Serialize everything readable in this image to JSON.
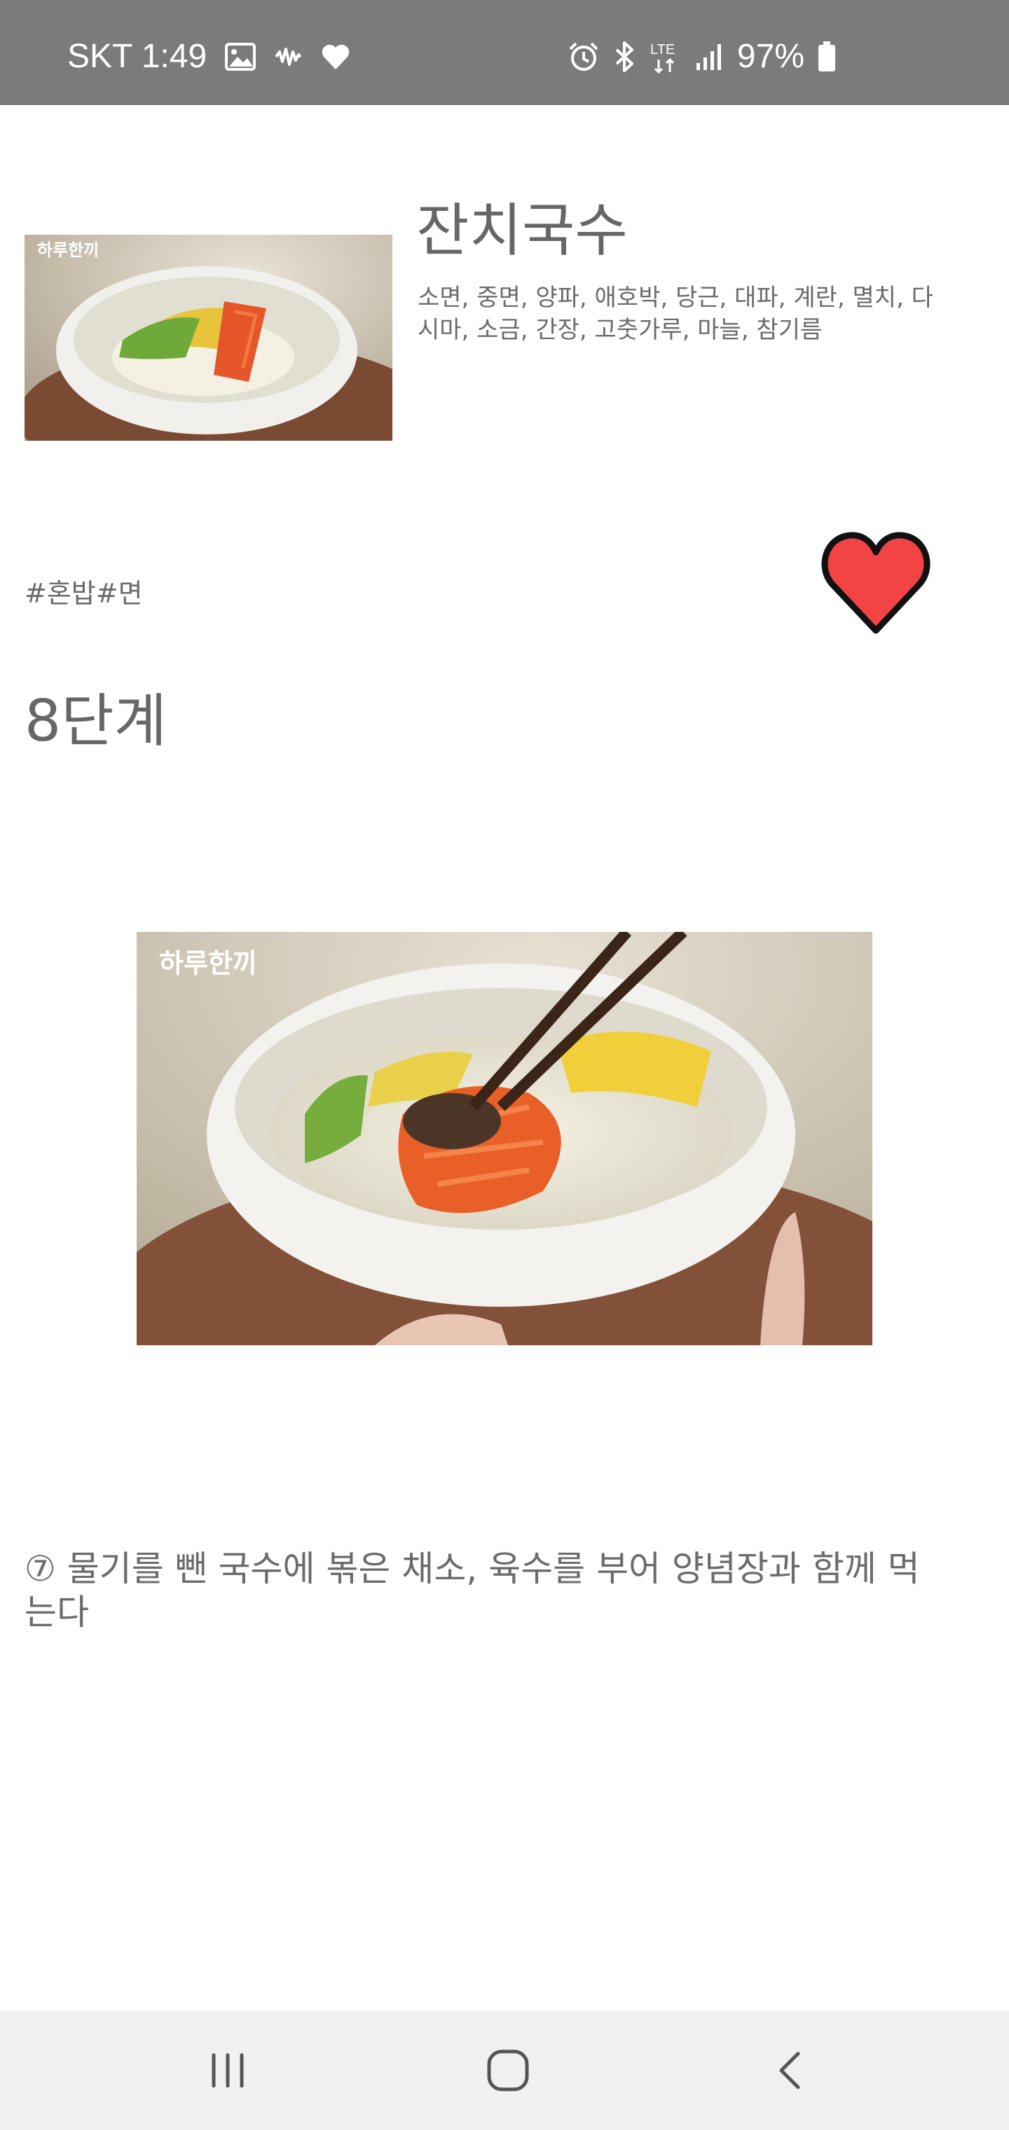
{
  "status_bar": {
    "time": "SKT 1:49",
    "network": "LTE",
    "battery": "97%",
    "left_icons": [
      "gallery-icon",
      "voicemail-wave-icon",
      "heart-notification-icon"
    ],
    "right_icons": [
      "alarm-icon",
      "bluetooth-icon",
      "lte-data-icon",
      "signal-icon",
      "battery-icon"
    ]
  },
  "recipe": {
    "title": "잔치국수",
    "ingredients": "소면, 중면, 양파, 애호박, 당근, 대파, 계란, 멸치, 다시마, 소금, 간장, 고춧가루, 마늘, 참기름",
    "hashtags": "#혼밥#면",
    "thumbnail_watermark": "하루한끼",
    "favorite": true
  },
  "step": {
    "title": "8단계",
    "image_watermark": "하루한끼",
    "description": "⑦ 물기를 뺀 국수에 볶은 채소, 육수를 부어 양념장과 함께 먹는다"
  },
  "nav_bar": {
    "icons": [
      "recent-apps-icon",
      "home-icon",
      "back-icon"
    ]
  },
  "colors": {
    "status_bar": "#7b7b7b",
    "heart": "#f24444",
    "text": "#666666",
    "nav_bar": "#f1f1f1"
  }
}
